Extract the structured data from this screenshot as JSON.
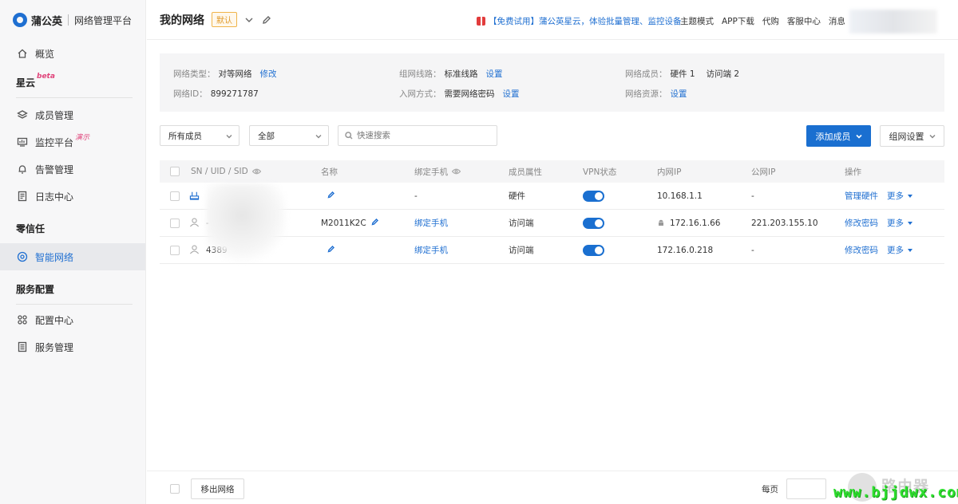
{
  "brand": {
    "name": "蒲公英",
    "subtitle": "网络管理平台"
  },
  "sidebar": {
    "overview": "概览",
    "group_xingyun": {
      "label": "星云",
      "badge": "beta"
    },
    "members": "成员管理",
    "monitor": {
      "label": "监控平台",
      "badge": "演示"
    },
    "alerts": "告警管理",
    "logs": "日志中心",
    "group_zerotrust": "零信任",
    "smart_network": "智能网络",
    "group_service": "服务配置",
    "config_center": "配置中心",
    "service_mgmt": "服务管理"
  },
  "header": {
    "title": "我的网络",
    "default_badge": "默认",
    "promo": "【免费试用】蒲公英星云，体验批量管理、监控设备",
    "links": [
      "主题模式",
      "APP下载",
      "代购",
      "客服中心",
      "消息"
    ]
  },
  "info": {
    "network_type_label": "网络类型：",
    "network_type_value": "对等网络",
    "network_type_action": "修改",
    "network_id_label": "网络ID：",
    "network_id_value": "899271787",
    "route_label": "组网线路：",
    "route_value": "标准线路",
    "route_action": "设置",
    "join_label": "入网方式：",
    "join_value": "需要网络密码",
    "join_action": "设置",
    "members_label": "网络成员：",
    "members_hardware": "硬件 1",
    "members_visitors": "访问端 2",
    "resources_label": "网络资源：",
    "resources_action": "设置"
  },
  "toolbar": {
    "filter_members": "所有成员",
    "filter_status": "全部",
    "search_placeholder": "快速搜索",
    "add_member": "添加成员",
    "network_settings": "组网设置"
  },
  "table": {
    "headers": {
      "id": "SN / UID / SID",
      "name": "名称",
      "phone": "绑定手机",
      "attr": "成员属性",
      "vpn": "VPN状态",
      "lan_ip": "内网IP",
      "wan_ip": "公网IP",
      "ops": "操作"
    },
    "rows": [
      {
        "id": "1",
        "name": "",
        "phone": "-",
        "attr": "硬件",
        "lan_ip": "10.168.1.1",
        "wan_ip": "-",
        "op1": "管理硬件",
        "op2": "更多"
      },
      {
        "id": "- 2",
        "name": "M2011K2C",
        "phone": "绑定手机",
        "attr": "访问端",
        "lan_ip": "172.16.1.66",
        "wan_ip": "221.203.155.10",
        "op1": "修改密码",
        "op2": "更多"
      },
      {
        "id": "4389",
        "name": "",
        "phone": "绑定手机",
        "attr": "访问端",
        "lan_ip": "172.16.0.218",
        "wan_ip": "-",
        "op1": "修改密码",
        "op2": "更多"
      }
    ]
  },
  "footer": {
    "exit_network": "移出网络",
    "per_page": "每页"
  },
  "watermark": {
    "brand": "路由器",
    "url": "www.bjjdwx.com"
  },
  "colors": {
    "accent": "#1a6fd0",
    "badge": "#e09a2a",
    "watermark_url": "#2ee02e"
  }
}
